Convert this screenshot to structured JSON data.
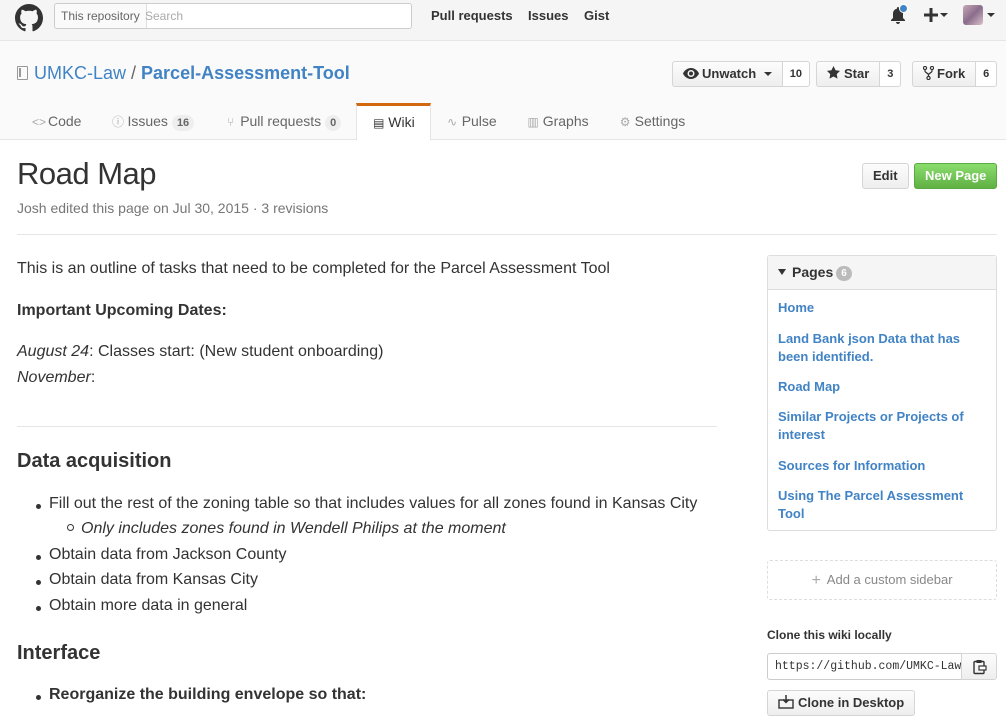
{
  "header": {
    "search_scope": "This repository",
    "search_placeholder": "Search",
    "nav": [
      "Pull requests",
      "Issues",
      "Gist"
    ]
  },
  "repo": {
    "owner": "UMKC-Law",
    "separator": "/",
    "name": "Parcel-Assessment-Tool",
    "watch_label": "Unwatch",
    "watch_count": "10",
    "star_label": "Star",
    "star_count": "3",
    "fork_label": "Fork",
    "fork_count": "6"
  },
  "tabs": {
    "code": "Code",
    "issues": "Issues",
    "issues_count": "16",
    "pulls": "Pull requests",
    "pulls_count": "0",
    "wiki": "Wiki",
    "pulse": "Pulse",
    "graphs": "Graphs",
    "settings": "Settings"
  },
  "wiki": {
    "title": "Road Map",
    "meta": "Josh edited this page on Jul 30, 2015 · 3 revisions",
    "edit_label": "Edit",
    "new_page_label": "New Page"
  },
  "body": {
    "intro": "This is an outline of tasks that need to be completed for the Parcel Assessment Tool",
    "dates_heading": "Important Upcoming Dates:",
    "date1_term": "August 24",
    "date1_text": ": Classes start: (New student onboarding)",
    "date2_term": "November",
    "date2_text": ":",
    "section1": "Data acquisition",
    "items": [
      "Fill out the rest of the zoning table so that includes values for all zones found in Kansas City",
      "Only includes zones found in Wendell Philips at the moment",
      "Obtain data from Jackson County",
      "Obtain data from Kansas City",
      "Obtain more data in general"
    ],
    "section2": "Interface",
    "interface_item": "Reorganize the building envelope so that:"
  },
  "sidebar": {
    "pages_label": "Pages",
    "pages_count": "6",
    "pages": [
      "Home",
      "Land Bank json Data that has been identified.",
      "Road Map",
      "Similar Projects or Projects of interest",
      "Sources for Information",
      "Using The Parcel Assessment Tool"
    ],
    "custom_sidebar": "Add a custom sidebar",
    "clone_label": "Clone this wiki locally",
    "clone_url": "https://github.com/UMKC-Law/Parcel-Assessment-Tool.wiki.git",
    "clone_desktop": "Clone in Desktop"
  }
}
